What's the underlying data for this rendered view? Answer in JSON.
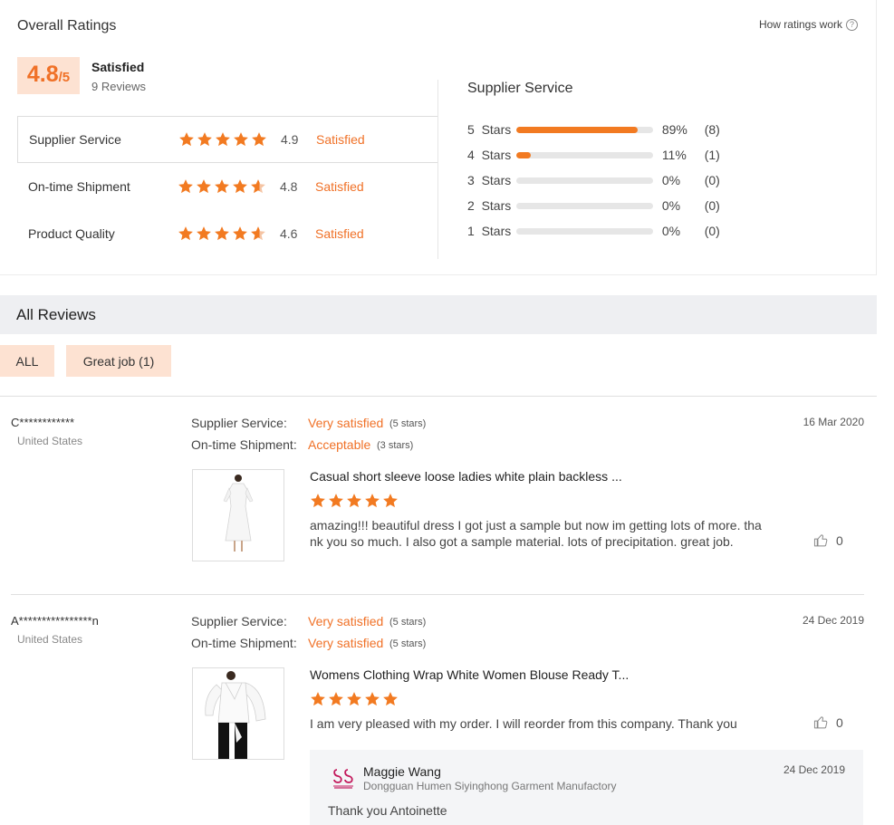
{
  "overall": {
    "title": "Overall Ratings",
    "how_ratings_work": "How ratings work",
    "score": "4.8",
    "score_denominator": "/5",
    "score_label": "Satisfied",
    "review_count": "9 Reviews",
    "categories": [
      {
        "name": "Supplier Service",
        "value": "4.9",
        "rating": 4.9,
        "label": "Satisfied"
      },
      {
        "name": "On-time Shipment",
        "value": "4.8",
        "rating": 4.8,
        "label": "Satisfied"
      },
      {
        "name": "Product Quality",
        "value": "4.6",
        "rating": 4.6,
        "label": "Satisfied"
      }
    ],
    "colors": {
      "accent": "#f07127",
      "star": "#f27a21",
      "score_bg": "#fde2d2"
    }
  },
  "supplier_service": {
    "title": "Supplier Service",
    "bars": [
      {
        "num": "5",
        "unit": "Stars",
        "percent": "89%",
        "fill": 0.89,
        "count": "(8)"
      },
      {
        "num": "4",
        "unit": "Stars",
        "percent": "11%",
        "fill": 0.11,
        "count": "(1)"
      },
      {
        "num": "3",
        "unit": "Stars",
        "percent": "0%",
        "fill": 0,
        "count": "(0)"
      },
      {
        "num": "2",
        "unit": "Stars",
        "percent": "0%",
        "fill": 0,
        "count": "(0)"
      },
      {
        "num": "1",
        "unit": "Stars",
        "percent": "0%",
        "fill": 0,
        "count": "(0)"
      }
    ]
  },
  "all_reviews": {
    "title": "All Reviews",
    "filters": [
      "ALL",
      "Great job (1)"
    ]
  },
  "reviews": [
    {
      "user": "C************",
      "country": "United States",
      "date": "16 Mar 2020",
      "fields": [
        {
          "label": "Supplier Service:",
          "value": "Very satisfied",
          "stars": "(5 stars)"
        },
        {
          "label": "On-time Shipment:",
          "value": "Acceptable",
          "stars": "(3 stars)"
        }
      ],
      "product": "Casual short sleeve loose ladies white plain backless ...",
      "rating": 5,
      "text": "amazing!!! beautiful dress I got just a sample but now im getting lots of more. tha nk you so much. I also got a sample material. lots of precipitation. great job.",
      "likes": "0"
    },
    {
      "user": "A****************n",
      "country": "United States",
      "date": "24 Dec 2019",
      "fields": [
        {
          "label": "Supplier Service:",
          "value": "Very satisfied",
          "stars": "(5 stars)"
        },
        {
          "label": "On-time Shipment:",
          "value": "Very satisfied",
          "stars": "(5 stars)"
        }
      ],
      "product": "Womens Clothing Wrap White Women Blouse Ready T...",
      "rating": 5,
      "text": "I am very pleased with my order. I will reorder from this company. Thank you",
      "likes": "0",
      "reply": {
        "name": "Maggie Wang",
        "company": "Dongguan Humen Siyinghong Garment Manufactory",
        "date": "24 Dec 2019",
        "text": "Thank you Antoinette"
      }
    }
  ]
}
